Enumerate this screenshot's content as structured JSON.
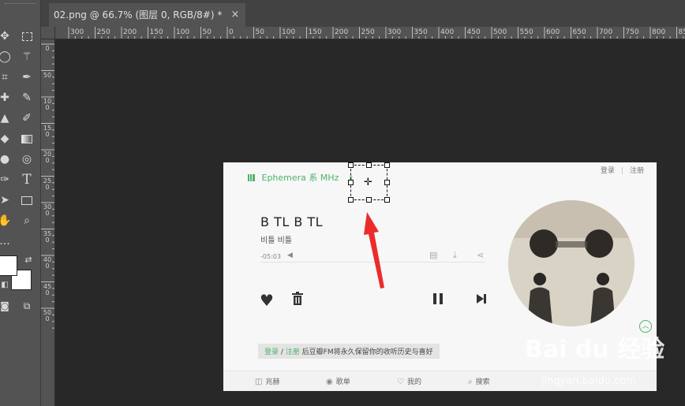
{
  "document_tab": {
    "title": "02.png @ 66.7% (图层 0, RGB/8#) *",
    "close": "×"
  },
  "ruler_top_labels": [
    "300",
    "250",
    "200",
    "150",
    "100",
    "50",
    "0",
    "50",
    "100",
    "150",
    "200",
    "250",
    "300",
    "350",
    "400",
    "450",
    "500",
    "550",
    "600",
    "650",
    "700",
    "750",
    "800",
    "850"
  ],
  "ruler_left_labels": [
    "0",
    "5 0",
    "1 0 0",
    "1 5 0",
    "2 0 0",
    "2 5 0",
    "3 0 0",
    "3 5 0",
    "4 0 0",
    "4 5 0",
    "5 0 0"
  ],
  "toolbar": {
    "icons": [
      "move-tool-icon",
      "marquee-tool-icon",
      "lasso-tool-icon",
      "magic-wand-tool-icon",
      "crop-tool-icon",
      "eyedropper-tool-icon",
      "healing-brush-tool-icon",
      "brush-tool-icon",
      "clone-stamp-tool-icon",
      "history-brush-tool-icon",
      "eraser-tool-icon",
      "gradient-tool-icon",
      "blur-tool-icon",
      "dodge-tool-icon",
      "pen-tool-icon",
      "type-tool-icon",
      "path-selection-tool-icon",
      "rectangle-tool-icon",
      "hand-tool-icon",
      "zoom-tool-icon",
      "more-tools-icon"
    ],
    "type_glyph": "T",
    "more_glyph": "...",
    "foreground_color": "#ffffff",
    "background_color": "#ffffff"
  },
  "fm_page": {
    "channel": "Ephemera 系 MHz",
    "login": "登录",
    "separator": "|",
    "register": "注册",
    "song_title": "B TL B TL",
    "artist": "비틀 비틀",
    "time": "-05:03",
    "hint_login": "登录",
    "hint_slash": " / ",
    "hint_register": "注册",
    "hint_text": " 后豆瓣FM将永久保留你的收听历史与喜好",
    "nav": [
      {
        "label": "兆赫",
        "icon": "radio-icon"
      },
      {
        "label": "歌单",
        "icon": "playlist-icon"
      },
      {
        "label": "我的",
        "icon": "heart-outline-icon"
      },
      {
        "label": "搜索",
        "icon": "search-icon"
      }
    ],
    "accent_color": "#4db26a"
  },
  "watermark": {
    "brand": "Bai du 经验",
    "url": "jingyan.baidu.com"
  }
}
